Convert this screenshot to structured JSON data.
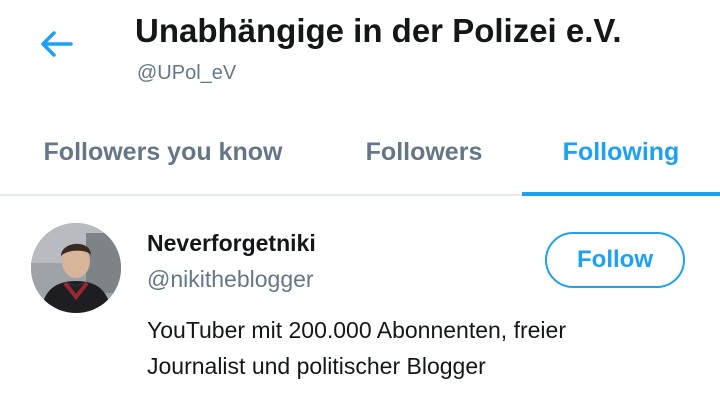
{
  "header": {
    "title": "Unabhängige in der Polizei e.V.",
    "handle": "@UPol_eV"
  },
  "tabs": [
    {
      "label": "Followers you know",
      "active": false
    },
    {
      "label": "Followers",
      "active": false
    },
    {
      "label": "Following",
      "active": true
    }
  ],
  "user": {
    "name": "Neverforgetniki",
    "handle": "@nikitheblogger",
    "bio_line1": "YouTuber mit 200.000 Abonnenten, freier",
    "bio_line2": "Journalist und politischer Blogger",
    "follow_label": "Follow"
  },
  "colors": {
    "accent": "#1da1f2",
    "text": "#14171a",
    "secondary": "#657786",
    "divider": "#e6ecf0"
  }
}
